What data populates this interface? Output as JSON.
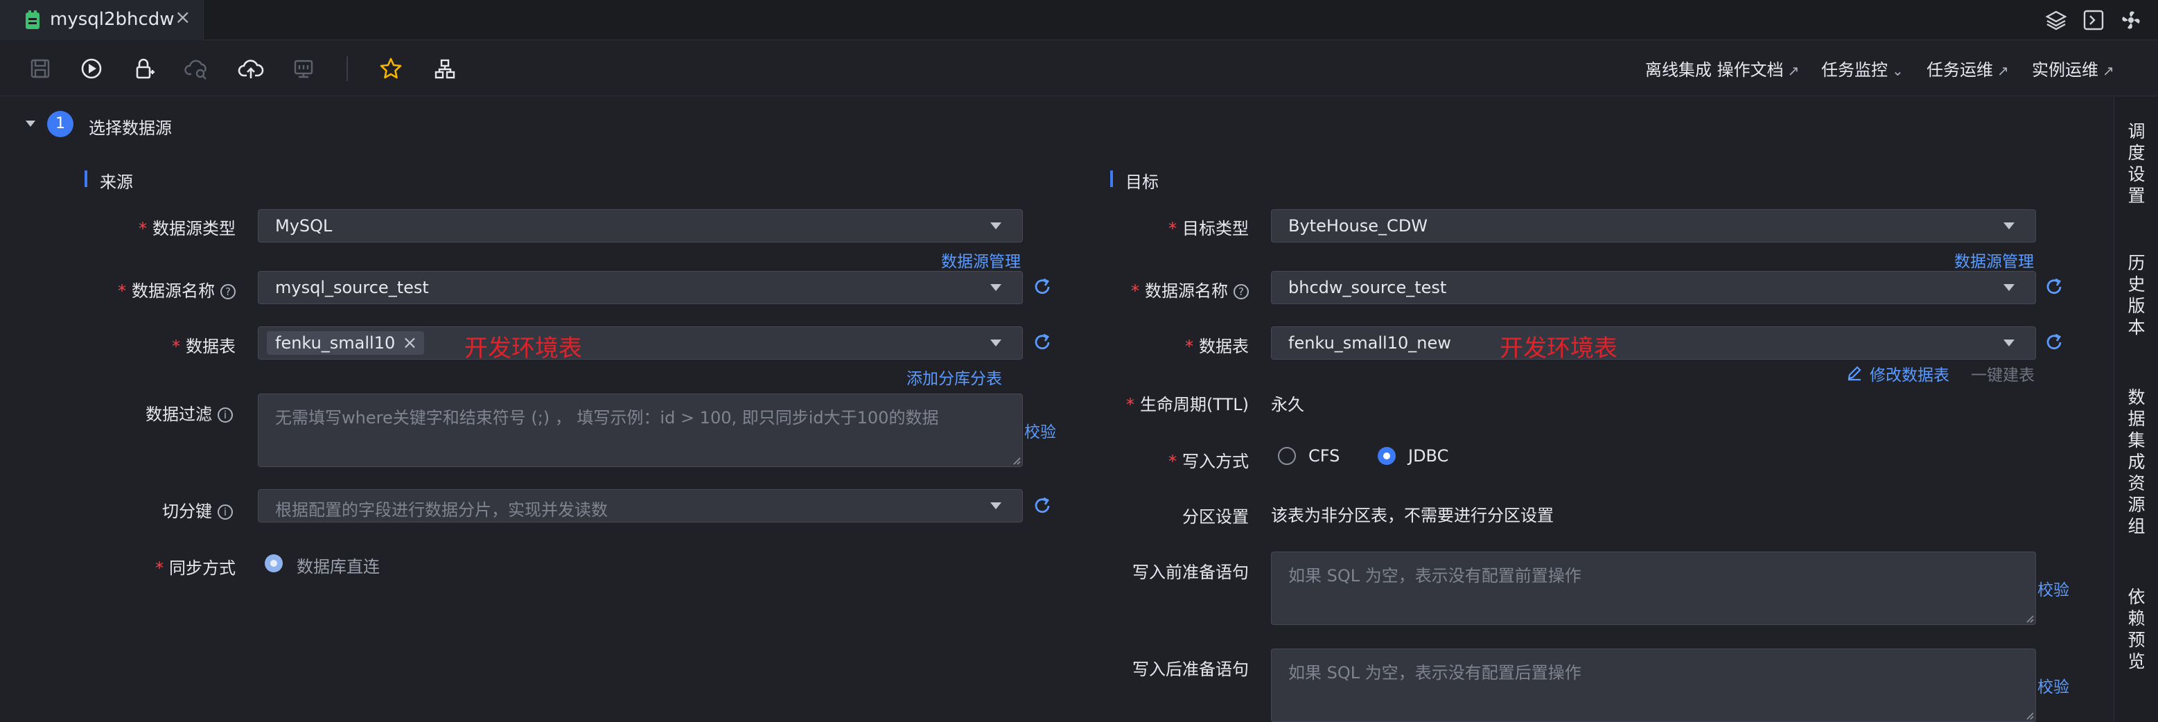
{
  "tab": {
    "title": "mysql2bhcdw",
    "close": "×"
  },
  "toolbar_links": {
    "docs": "离线集成 操作文档",
    "task_monitor": "任务监控",
    "task_ops": "任务运维",
    "instance_ops": "实例运维"
  },
  "section": {
    "step": "1",
    "title": "选择数据源"
  },
  "source": {
    "title": "来源",
    "type_label": "数据源类型",
    "type_value": "MySQL",
    "manage_link": "数据源管理",
    "name_label": "数据源名称",
    "name_value": "mysql_source_test",
    "table_label": "数据表",
    "table_chip": "fenku_small10",
    "chip_close": "×",
    "annotation": "开发环境表",
    "add_shard_link": "添加分库分表",
    "filter_label": "数据过滤",
    "filter_placeholder": "无需填写where关键字和结束符号 (;) ， 填写示例：id > 100, 即只同步id大于100的数据",
    "validate": "校验",
    "split_label": "切分键",
    "split_placeholder": "根据配置的字段进行数据分片，实现并发读数",
    "sync_label": "同步方式",
    "sync_option": "数据库直连"
  },
  "target": {
    "title": "目标",
    "type_label": "目标类型",
    "type_value": "ByteHouse_CDW",
    "manage_link": "数据源管理",
    "name_label": "数据源名称",
    "name_value": "bhcdw_source_test",
    "table_label": "数据表",
    "table_value": "fenku_small10_new",
    "annotation": "开发环境表",
    "modify_link": "修改数据表",
    "one_click": "一键建表",
    "ttl_label": "生命周期(TTL)",
    "ttl_value": "永久",
    "write_label": "写入方式",
    "write_options": [
      "CFS",
      "JDBC"
    ],
    "write_selected": "JDBC",
    "partition_label": "分区设置",
    "partition_value": "该表为非分区表，不需要进行分区设置",
    "pre_label": "写入前准备语句",
    "pre_placeholder": "如果 SQL 为空，表示没有配置前置操作",
    "post_label": "写入后准备语句",
    "post_placeholder": "如果 SQL 为空，表示没有配置后置操作",
    "validate": "校验"
  },
  "side_panel": [
    "调度设置",
    "历史版本",
    "数据集成资源组",
    "依赖预览"
  ],
  "colors": {
    "accent": "#3d7af5",
    "link": "#5b9bff",
    "required": "#f0454c",
    "annotation": "#e1222a",
    "background": "#1f2127"
  }
}
